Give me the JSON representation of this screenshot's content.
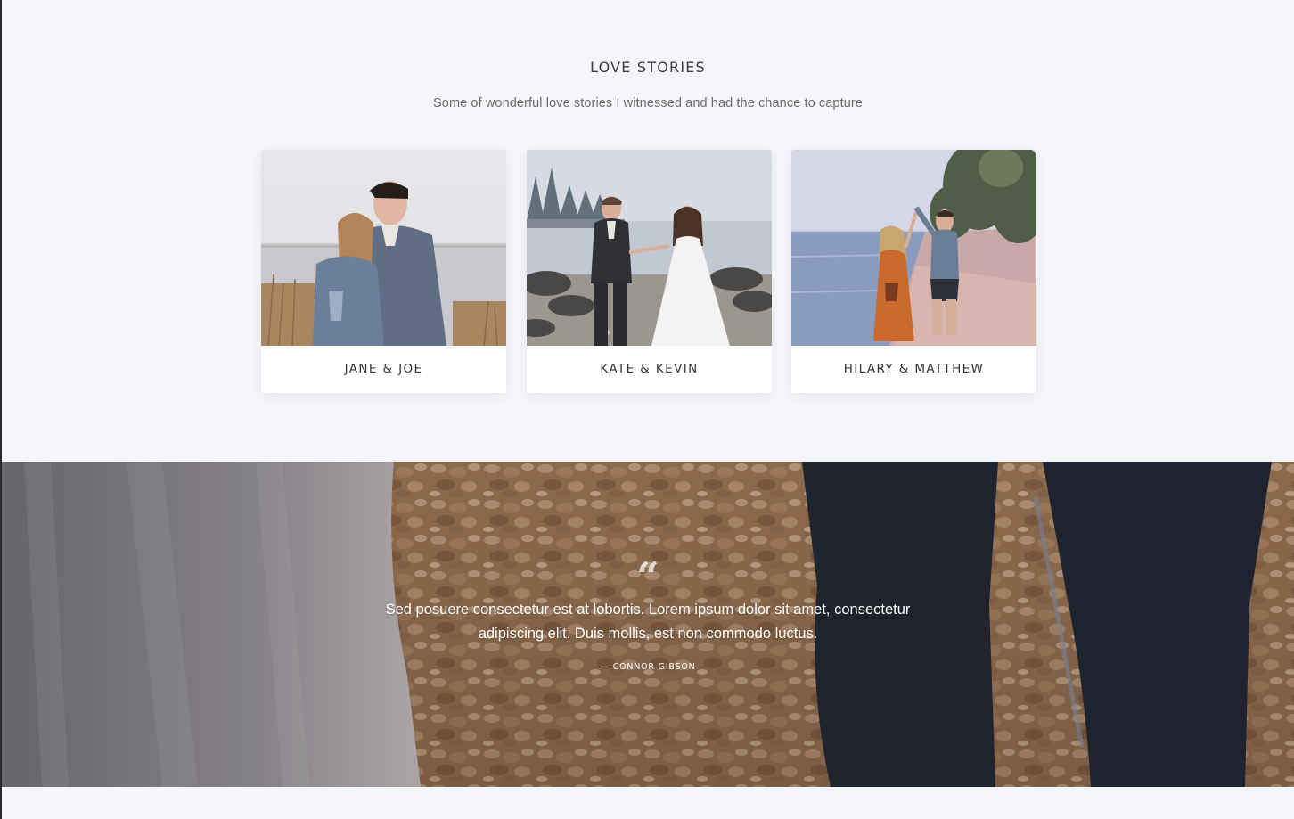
{
  "love_stories": {
    "title": "LOVE STORIES",
    "subtitle": "Some of wonderful love stories I witnessed and had the chance to capture",
    "cards": [
      {
        "name": "JANE & JOE"
      },
      {
        "name": "KATE & KEVIN"
      },
      {
        "name": "HILARY & MATTHEW"
      }
    ]
  },
  "testimonial": {
    "quote_mark": "“",
    "text": "Sed posuere consectetur est at lobortis. Lorem ipsum dolor sit amet, consectetur adipiscing elit. Duis mollis, est non commodo luctus.",
    "author": "— CONNOR GIBSON"
  },
  "colors": {
    "page_background": "#f5f6fa",
    "card_background": "#ffffff",
    "heading_text": "#3a3a3a",
    "subtitle_text": "#6a6a6a"
  }
}
